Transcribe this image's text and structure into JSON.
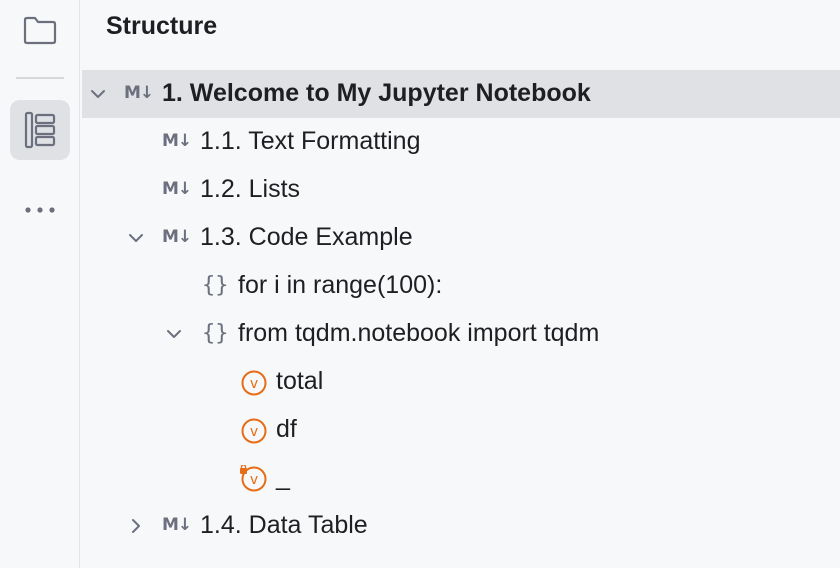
{
  "sidebar": {
    "buttons": [
      {
        "icon": "folder-icon"
      },
      {
        "icon": "structure-icon",
        "active": true
      },
      {
        "icon": "more-icon"
      }
    ]
  },
  "panel": {
    "title": "Structure"
  },
  "tree": [
    {
      "label": "1. Welcome to My Jupyter Notebook",
      "icon": "markdown-icon",
      "badge": "M↓",
      "expanded": true,
      "selected": true,
      "bold": true
    },
    {
      "label": "1.1. Text Formatting",
      "icon": "markdown-icon",
      "badge": "M↓"
    },
    {
      "label": "1.2. Lists",
      "icon": "markdown-icon",
      "badge": "M↓"
    },
    {
      "label": "1.3. Code Example",
      "icon": "markdown-icon",
      "badge": "M↓",
      "expanded": true
    },
    {
      "label": "for i in range(100):",
      "icon": "code-cell-icon",
      "badge": "{}"
    },
    {
      "label": "from tqdm.notebook import tqdm",
      "icon": "code-cell-icon",
      "badge": "{}",
      "expanded": true
    },
    {
      "label": "total",
      "icon": "variable-icon",
      "badge": "v"
    },
    {
      "label": "df",
      "icon": "variable-icon",
      "badge": "v"
    },
    {
      "label": "_",
      "icon": "private-variable-icon",
      "badge": "v"
    },
    {
      "label": "1.4. Data Table",
      "icon": "markdown-icon",
      "badge": "M↓",
      "expanded": false
    }
  ],
  "colors": {
    "background": "#f7f8fa",
    "selection": "#dfe1e5",
    "variable_orange": "#e66d17",
    "icon_gray": "#6c707e"
  }
}
